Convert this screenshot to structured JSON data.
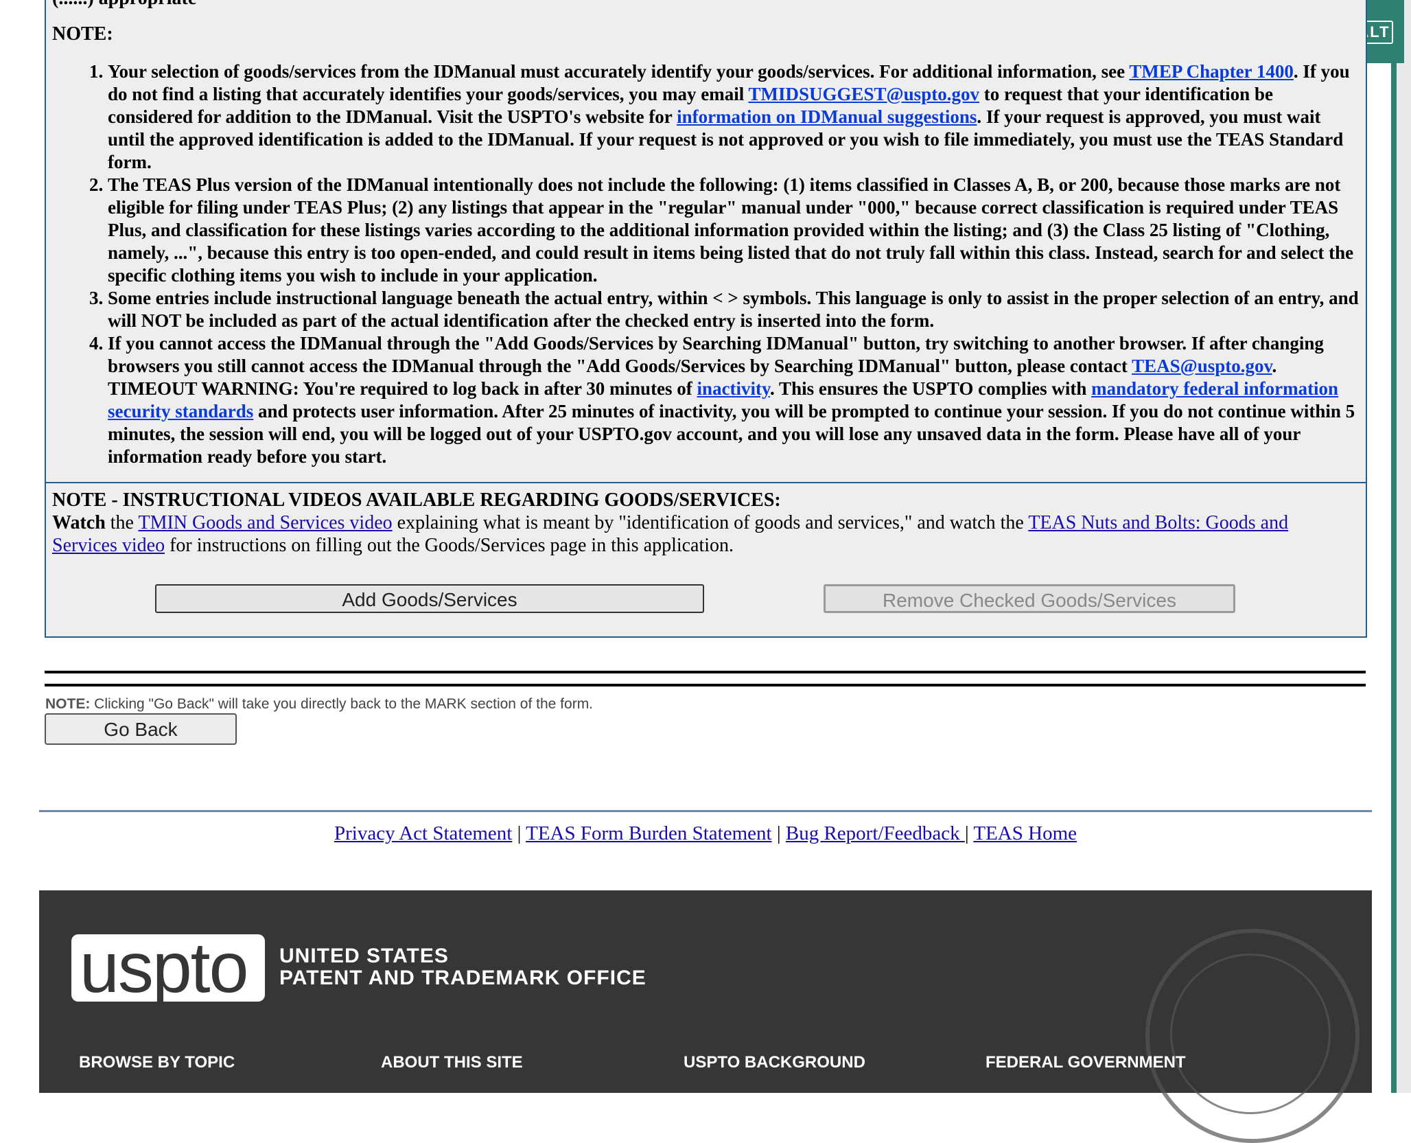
{
  "top_cut_text": "(......)  appropriate",
  "note_label": "NOTE:",
  "notes": [
    {
      "t1": "Your selection of goods/services from the IDManual must accurately identify your goods/services. For additional information, see ",
      "link1": "TMEP Chapter 1400",
      "t2": ". If you do not find a listing that accurately identifies your goods/services, you may email ",
      "link2": "TMIDSUGGEST@uspto.gov",
      "t3": " to request that your identification be considered for addition to the IDManual. Visit the USPTO's website for ",
      "link3": "information on IDManual suggestions",
      "t4": ". If your request is approved, you must wait until the approved identification is added to the IDManual. If your request is not approved or you wish to file immediately, you must use the TEAS Standard form."
    },
    {
      "t1": "The TEAS Plus version of the IDManual intentionally does not include the following: (1) items classified in Classes A, B, or 200, because those marks are not eligible for filing under TEAS Plus; (2) any listings that appear in the \"regular\" manual under \"000,\" because correct classification is required under TEAS Plus, and classification for these listings varies according to the additional information provided within the listing; and (3) the Class 25 listing of \"Clothing, namely, ...\", because this entry is too open-ended, and could result in items being listed that do not truly fall within this class. Instead, search for and select the specific clothing items you wish to include in your application."
    },
    {
      "t1": "Some entries include instructional language beneath the actual entry, within < > symbols. This language is only to assist in the proper selection of an entry, and will NOT be included as part of the actual identification after the checked entry is inserted into the form."
    },
    {
      "t1": "If you cannot access the IDManual through the \"Add Goods/Services by Searching IDManual\" button, try switching to another browser. If after changing browsers you still cannot access the IDManual through the \"Add Goods/Services by Searching IDManual\" button, please contact ",
      "link1": "TEAS@uspto.gov",
      "t2": ".",
      "timeout_t1": "TIMEOUT WARNING: You're required to log back in after 30 minutes of ",
      "timeout_link1": "inactivity",
      "timeout_t2": ". This ensures the USPTO complies with ",
      "timeout_link2": "mandatory federal information security standards",
      "timeout_t3": " and protects user information. After 25 minutes of inactivity, you will be prompted to continue your session. If you do not continue within 5 minutes, the session will end, you will be logged out of your USPTO.gov account, and you will lose any unsaved data in the form. Please have all of your information ready before you start."
    }
  ],
  "videos": {
    "heading": "NOTE - INSTRUCTIONAL VIDEOS AVAILABLE REGARDING GOODS/SERVICES:",
    "watch": "Watch",
    "t1": " the ",
    "link1": "TMIN Goods and Services video",
    "t2": " explaining what is meant by \"identification of goods and services,\" and watch the ",
    "link2": "TEAS Nuts and Bolts: Goods and Services video",
    "t3": " for instructions on filling out the Goods/Services page in this application."
  },
  "buttons": {
    "add": "Add Goods/Services",
    "remove": "Remove Checked Goods/Services",
    "go_back": "Go Back"
  },
  "go_back_note": {
    "label": "NOTE:",
    "text": " Clicking \"Go Back\" will take you directly back to the MARK section of the form."
  },
  "footer_links": [
    "Privacy Act Statement",
    "TEAS Form Burden Statement",
    "Bug Report/Feedback ",
    "TEAS Home"
  ],
  "footer_separator": " | ",
  "alt_badge": "ALT",
  "brand": {
    "logo": "uspto",
    "line1": "UNITED STATES",
    "line2": "PATENT AND TRADEMARK OFFICE"
  },
  "footer_columns": [
    "BROWSE BY TOPIC",
    "ABOUT THIS SITE",
    "USPTO BACKGROUND",
    "FEDERAL GOVERNMENT"
  ],
  "colors": {
    "panel_bg": "#eeeeee",
    "panel_border": "#245e8c",
    "link": "#1a0dab",
    "accent_green": "#2e8071",
    "footer_bg": "#363636"
  }
}
